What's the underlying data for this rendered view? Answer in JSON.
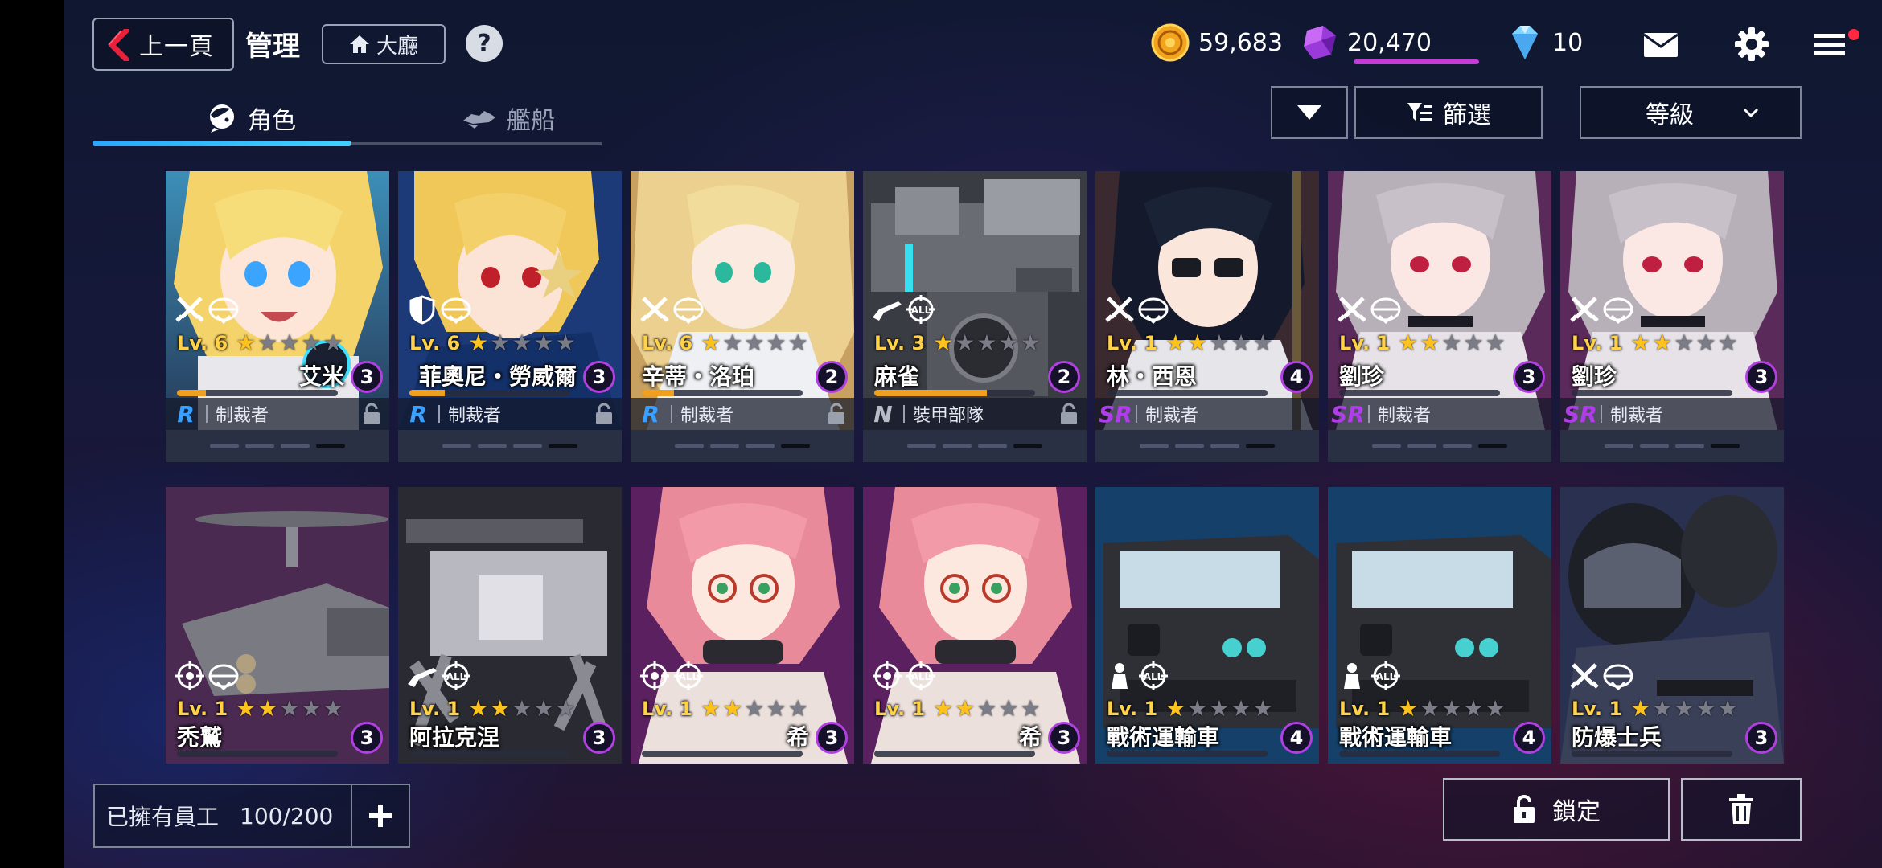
{
  "header": {
    "back_label": "上一頁",
    "title": "管理",
    "lobby_label": "大廳",
    "help_label": "?"
  },
  "resources": {
    "gold": "59,683",
    "gem": "20,470",
    "diamond": "10"
  },
  "tabs": [
    {
      "label": "角色",
      "active": true
    },
    {
      "label": "艦船",
      "active": false
    }
  ],
  "controls": {
    "filter_label": "篩選",
    "sort_label": "等級"
  },
  "cards": [
    {
      "name": "艾米",
      "level": "Lv. 6",
      "stars": 1,
      "rarity": "R",
      "faction": "制裁者",
      "cost": "3",
      "xp": 0.18
    },
    {
      "name": "菲奧尼・勞威爾",
      "level": "Lv. 6",
      "stars": 1,
      "rarity": "R",
      "faction": "制裁者",
      "cost": "3",
      "xp": 0.22
    },
    {
      "name": "辛蒂・洛珀",
      "level": "Lv. 6",
      "stars": 1,
      "rarity": "R",
      "faction": "制裁者",
      "cost": "2",
      "xp": 0.2
    },
    {
      "name": "麻雀",
      "level": "Lv. 3",
      "stars": 1,
      "rarity": "N",
      "faction": "裝甲部隊",
      "cost": "2",
      "xp": 0.7
    },
    {
      "name": "林・西恩",
      "level": "Lv. 1",
      "stars": 2,
      "rarity": "SR",
      "faction": "制裁者",
      "cost": "4",
      "xp": 0
    },
    {
      "name": "劉珍",
      "level": "Lv. 1",
      "stars": 2,
      "rarity": "SR",
      "faction": "制裁者",
      "cost": "3",
      "xp": 0
    },
    {
      "name": "劉珍",
      "level": "Lv. 1",
      "stars": 2,
      "rarity": "SR",
      "faction": "制裁者",
      "cost": "3",
      "xp": 0
    },
    {
      "name": "禿鷲",
      "level": "Lv. 1",
      "stars": 2,
      "cost": "3"
    },
    {
      "name": "阿拉克涅",
      "level": "Lv. 1",
      "stars": 2,
      "cost": "3"
    },
    {
      "name": "希",
      "level": "Lv. 1",
      "stars": 2,
      "cost": "3"
    },
    {
      "name": "希",
      "level": "Lv. 1",
      "stars": 2,
      "cost": "3"
    },
    {
      "name": "戰術運輸車",
      "level": "Lv. 1",
      "stars": 1,
      "cost": "4"
    },
    {
      "name": "戰術運輸車",
      "level": "Lv. 1",
      "stars": 1,
      "cost": "4"
    },
    {
      "name": "防爆士兵",
      "level": "Lv. 1",
      "stars": 1,
      "cost": "3"
    }
  ],
  "footer": {
    "owned_label": "已擁有員工",
    "owned_count": "100/200",
    "lock_label": "鎖定"
  },
  "colors": {
    "accent_blue": "#2aa7ff",
    "star_gold": "#ffc21a",
    "cost_ring": "#b040e0",
    "rarity_R": "#3aa0ff",
    "rarity_SR": "#b03ee8"
  }
}
